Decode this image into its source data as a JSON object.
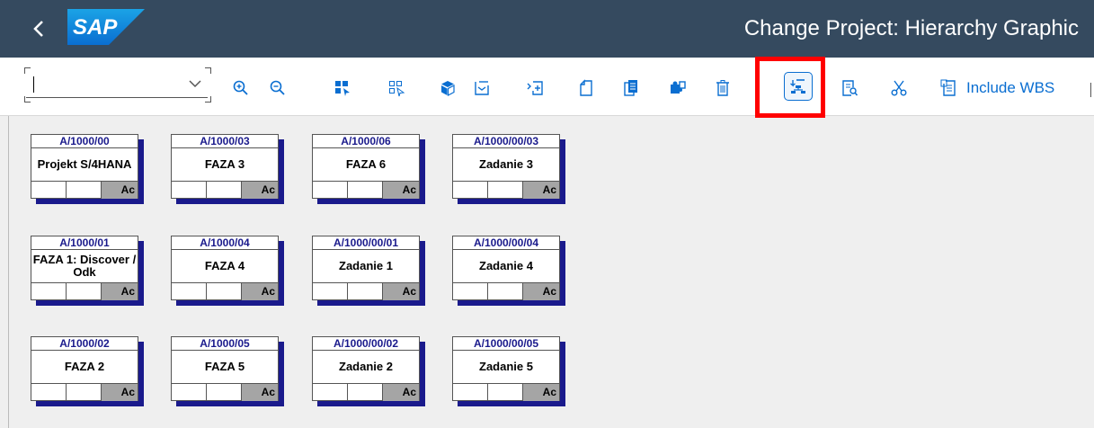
{
  "header": {
    "logo_text": "SAP",
    "title": "Change Project: Hierarchy Graphic"
  },
  "toolbar": {
    "combo_value": "",
    "include_wbs_label": "Include WBS",
    "icons": [
      "zoom-in-icon",
      "zoom-out-icon",
      "select-filled-icon",
      "select-outline-icon",
      "package-icon",
      "collapse-icon",
      "expand-icon",
      "new-document-icon",
      "copy-document-icon",
      "puzzle-icon",
      "delete-icon",
      "hierarchy-layout-icon",
      "search-document-icon",
      "cut-icon"
    ]
  },
  "colors": {
    "header_bg": "#354a5f",
    "accent": "#0a6ed1",
    "highlight": "#ff0000",
    "node_code": "#1a1a8c",
    "node_shadow": "#1a1a8c",
    "status_cell": "#a5a5a5"
  },
  "nodes": [
    {
      "code": "A/1000/00",
      "name": "Projekt S/4HANA",
      "status": "Ac"
    },
    {
      "code": "A/1000/03",
      "name": "FAZA 3",
      "status": "Ac"
    },
    {
      "code": "A/1000/06",
      "name": "FAZA 6",
      "status": "Ac"
    },
    {
      "code": "A/1000/00/03",
      "name": "Zadanie 3",
      "status": "Ac"
    },
    {
      "code": "A/1000/01",
      "name": "FAZA 1: Discover / Odk",
      "status": "Ac"
    },
    {
      "code": "A/1000/04",
      "name": "FAZA 4",
      "status": "Ac"
    },
    {
      "code": "A/1000/00/01",
      "name": "Zadanie 1",
      "status": "Ac"
    },
    {
      "code": "A/1000/00/04",
      "name": "Zadanie 4",
      "status": "Ac"
    },
    {
      "code": "A/1000/02",
      "name": "FAZA 2",
      "status": "Ac"
    },
    {
      "code": "A/1000/05",
      "name": "FAZA 5",
      "status": "Ac"
    },
    {
      "code": "A/1000/00/02",
      "name": "Zadanie 2",
      "status": "Ac"
    },
    {
      "code": "A/1000/00/05",
      "name": "Zadanie 5",
      "status": "Ac"
    }
  ]
}
